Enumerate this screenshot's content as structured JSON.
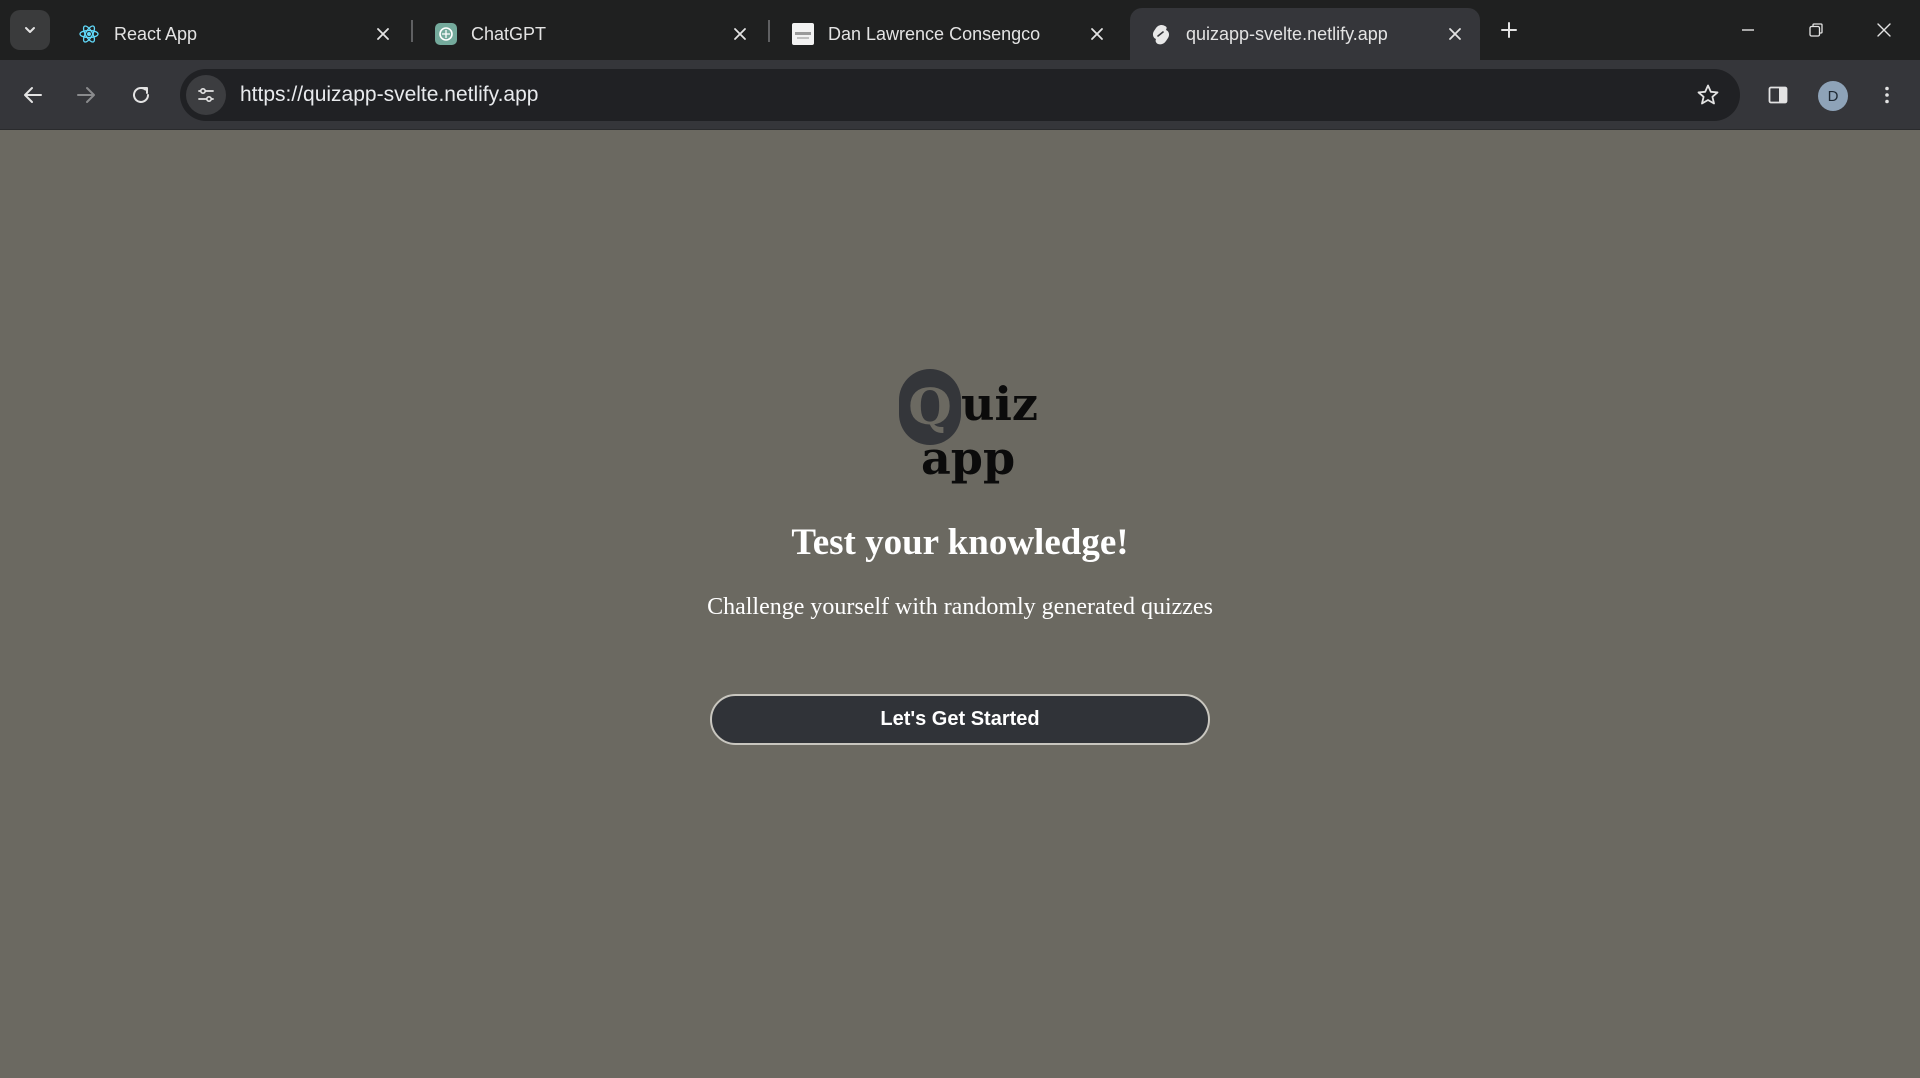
{
  "browser": {
    "tabs": [
      {
        "title": "React App",
        "icon": "react-icon",
        "active": false
      },
      {
        "title": "ChatGPT",
        "icon": "chatgpt-icon",
        "active": false
      },
      {
        "title": "Dan Lawrence Consengco",
        "icon": "site-thumbnail-icon",
        "active": false
      },
      {
        "title": "quizapp-svelte.netlify.app",
        "icon": "svelte-icon",
        "active": true
      }
    ],
    "url": "https://quizapp-svelte.netlify.app",
    "profile_initial": "D",
    "colors": {
      "tabstrip": "#1f2020",
      "toolbar": "#35363a",
      "omnibox": "#202124",
      "avatar": "#8ea3b8"
    }
  },
  "page": {
    "logo": {
      "letter": "Q",
      "rest": "uiz",
      "second_line": "app"
    },
    "headline": "Test your knowledge!",
    "subheadline": "Challenge yourself with randomly generated quizzes",
    "cta_label": "Let's Get Started",
    "colors": {
      "background": "#6b6961",
      "button": "#303338",
      "text": "#ffffff"
    }
  }
}
